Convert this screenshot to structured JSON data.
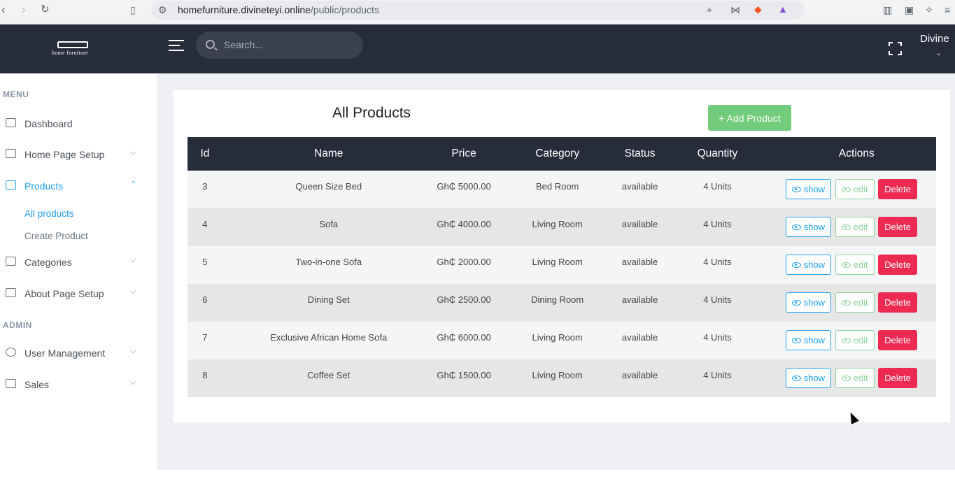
{
  "browser": {
    "url_host": "homefurniture.divineteyi.online",
    "url_path": "/public/products"
  },
  "topbar": {
    "logo_text": "home furniture",
    "search_placeholder": "Search...",
    "user_name": "Divine"
  },
  "sidebar": {
    "menu_title": "MENU",
    "admin_title": "ADMIN",
    "items": [
      {
        "label": "Dashboard"
      },
      {
        "label": "Home Page Setup"
      },
      {
        "label": "Products"
      },
      {
        "label": "Categories"
      },
      {
        "label": "About Page Setup"
      },
      {
        "label": "User Management"
      },
      {
        "label": "Sales"
      }
    ],
    "products_sub": [
      {
        "label": "All products"
      },
      {
        "label": "Create Product"
      }
    ]
  },
  "main": {
    "title": "All Products",
    "add_button": "+ Add Product",
    "columns": [
      "Id",
      "Name",
      "Price",
      "Category",
      "Status",
      "Quantity",
      "Actions"
    ],
    "rows": [
      {
        "id": "3",
        "name": "Queen Size Bed",
        "price": "Gh₵ 5000.00",
        "category": "Bed Room",
        "status": "available",
        "quantity": "4 Units"
      },
      {
        "id": "4",
        "name": "Sofa",
        "price": "Gh₵ 4000.00",
        "category": "Living Room",
        "status": "available",
        "quantity": "4 Units"
      },
      {
        "id": "5",
        "name": "Two-in-one Sofa",
        "price": "Gh₵ 2000.00",
        "category": "Living Room",
        "status": "available",
        "quantity": "4 Units"
      },
      {
        "id": "6",
        "name": "Dining Set",
        "price": "Gh₵ 2500.00",
        "category": "Dining Room",
        "status": "available",
        "quantity": "4 Units"
      },
      {
        "id": "7",
        "name": "Exclusive African Home Sofa",
        "price": "Gh₵ 6000.00",
        "category": "Living Room",
        "status": "available",
        "quantity": "4 Units"
      },
      {
        "id": "8",
        "name": "Coffee Set",
        "price": "Gh₵ 1500.00",
        "category": "Living Room",
        "status": "available",
        "quantity": "4 Units"
      }
    ],
    "action_labels": {
      "show": "show",
      "edit": "edit",
      "delete": "Delete"
    }
  },
  "colors": {
    "topbar": "#272c3b",
    "accent": "#1e9ff2",
    "add_button": "#72cc7c",
    "delete": "#ed2a52"
  }
}
